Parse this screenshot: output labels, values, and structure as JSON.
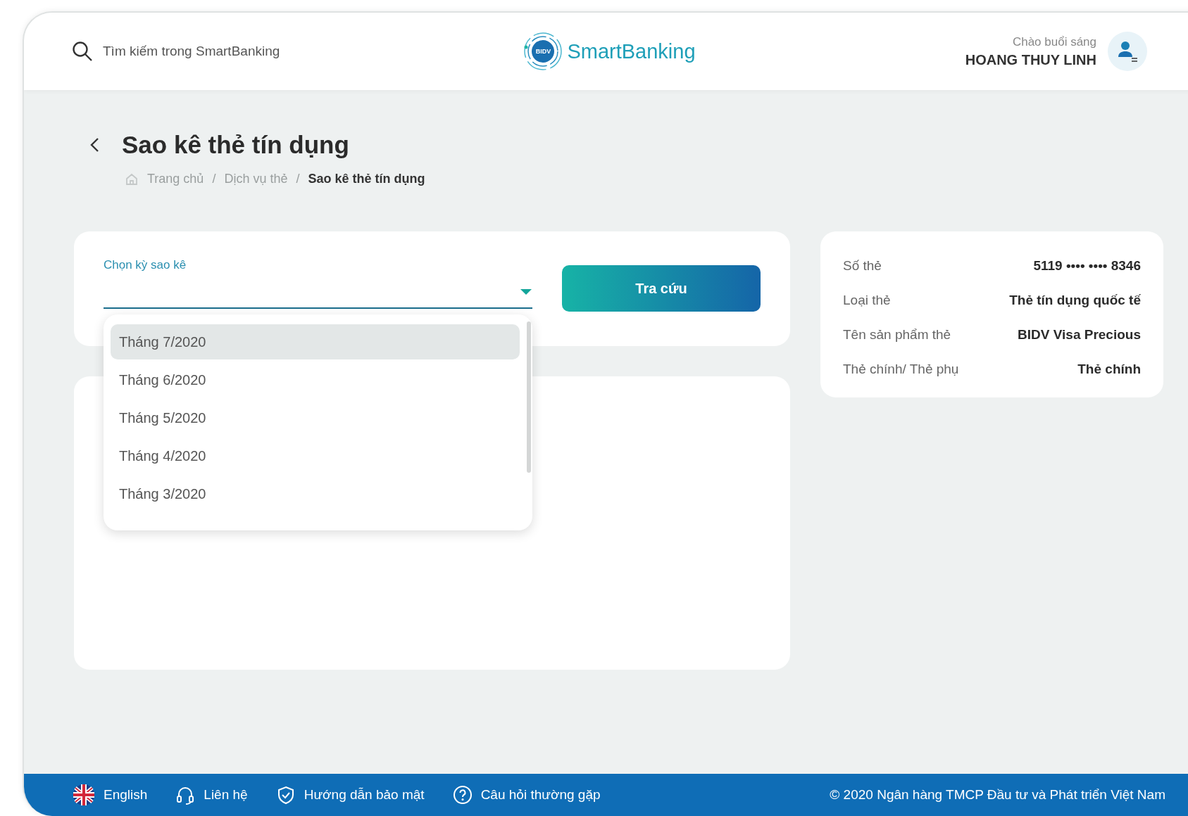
{
  "header": {
    "search": {
      "placeholder": "Tìm kiếm trong SmartBanking"
    },
    "logo": {
      "badge": "BIDV",
      "name": "SmartBanking"
    },
    "greeting": "Chào buổi sáng",
    "user_name": "HOANG THUY LINH"
  },
  "page": {
    "title": "Sao kê thẻ tín dụng",
    "breadcrumb_separator": "/",
    "breadcrumb": [
      {
        "label": "Trang chủ",
        "current": false
      },
      {
        "label": "Dịch vụ thẻ",
        "current": false
      },
      {
        "label": "Sao kê thẻ tín dụng",
        "current": true
      }
    ]
  },
  "statement_form": {
    "period_field": {
      "label": "Chọn kỳ sao kê",
      "expanded": true
    },
    "options": [
      {
        "label": "Tháng 7/2020",
        "selected": true
      },
      {
        "label": "Tháng 6/2020",
        "selected": false
      },
      {
        "label": "Tháng 5/2020",
        "selected": false
      },
      {
        "label": "Tháng 4/2020",
        "selected": false
      },
      {
        "label": "Tháng 3/2020",
        "selected": false
      }
    ],
    "submit": "Tra cứu"
  },
  "card_info": [
    {
      "label": "Số thẻ",
      "value": "5119 •••• •••• 8346"
    },
    {
      "label": "Loại thẻ",
      "value": "Thẻ tín dụng quốc tế"
    },
    {
      "label": "Tên sản phẩm thẻ",
      "value": "BIDV Visa Precious"
    },
    {
      "label": "Thẻ chính/ Thẻ phụ",
      "value": "Thẻ chính"
    }
  ],
  "footer": {
    "links": [
      {
        "kind": "language",
        "label": "English"
      },
      {
        "kind": "contact",
        "label": "Liên hệ"
      },
      {
        "kind": "security",
        "label": "Hướng dẫn bảo mật"
      },
      {
        "kind": "faq",
        "label": "Câu hỏi thường gặp"
      }
    ],
    "copyright": "© 2020 Ngân hàng TMCP Đầu tư và Phát triển Việt Nam"
  }
}
